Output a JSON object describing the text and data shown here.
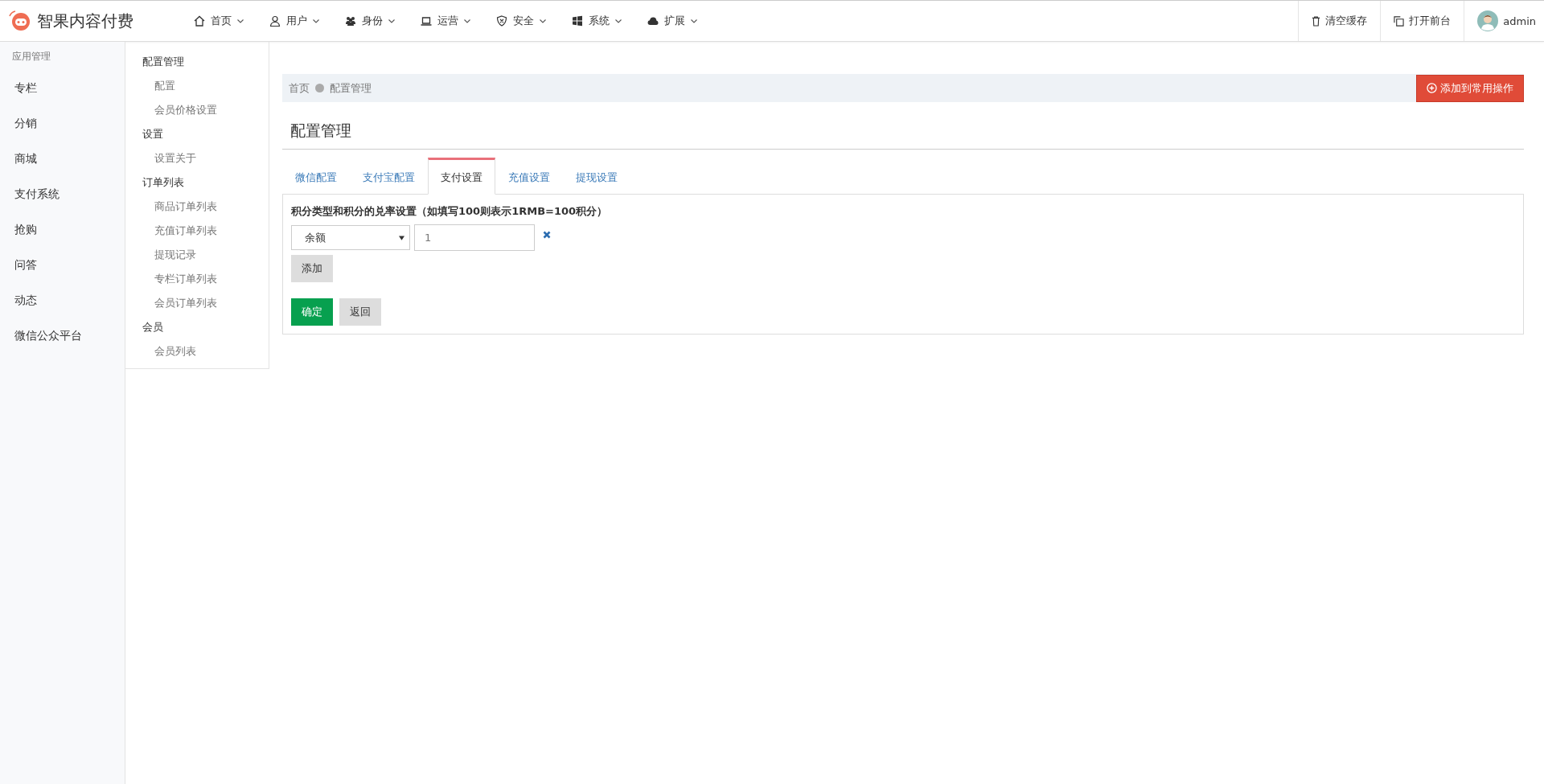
{
  "header": {
    "brand": "智果内容付费",
    "nav": [
      {
        "label": "首页"
      },
      {
        "label": "用户"
      },
      {
        "label": "身份"
      },
      {
        "label": "运营"
      },
      {
        "label": "安全"
      },
      {
        "label": "系统"
      },
      {
        "label": "扩展"
      }
    ],
    "actions": [
      {
        "label": "清空缓存"
      },
      {
        "label": "打开前台"
      }
    ],
    "user": "admin"
  },
  "sidebar": {
    "title": "应用管理",
    "items": [
      "专栏",
      "分销",
      "商城",
      "支付系统",
      "抢购",
      "问答",
      "动态",
      "微信公众平台"
    ]
  },
  "subnav": [
    {
      "label": "配置管理",
      "children": [
        "配置",
        "会员价格设置"
      ]
    },
    {
      "label": "设置",
      "children": [
        "设置关于"
      ]
    },
    {
      "label": "订单列表",
      "children": [
        "商品订单列表",
        "充值订单列表",
        "提现记录",
        "专栏订单列表",
        "会员订单列表"
      ]
    },
    {
      "label": "会员",
      "children": [
        "会员列表"
      ]
    }
  ],
  "breadcrumb": [
    "首页",
    "配置管理"
  ],
  "add_button": "添加到常用操作",
  "page_title": "配置管理",
  "tabs": [
    {
      "label": "微信配置",
      "selected": false
    },
    {
      "label": "支付宝配置",
      "selected": false
    },
    {
      "label": "支付设置",
      "selected": true
    },
    {
      "label": "充值设置",
      "selected": false
    },
    {
      "label": "提现设置",
      "selected": false
    }
  ],
  "form": {
    "label": "积分类型和积分的兑率设置（如填写100则表示1RMB=100积分）",
    "rows": [
      {
        "type": "余额",
        "value": "1"
      }
    ],
    "add": "添加",
    "submit": "确定",
    "back": "返回"
  }
}
